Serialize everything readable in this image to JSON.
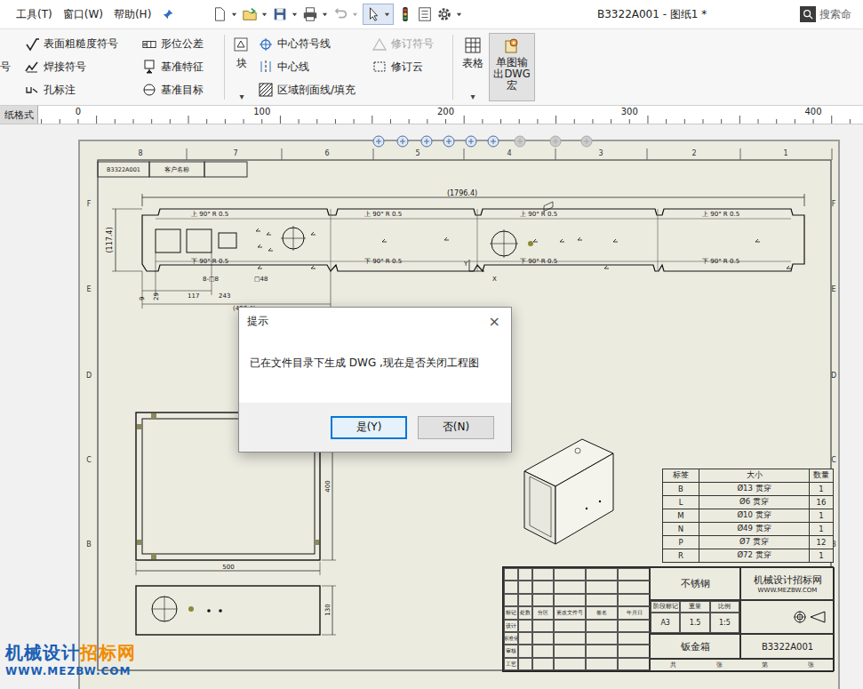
{
  "menubar": {
    "menus": [
      {
        "label": "工具(T)"
      },
      {
        "label": "窗口(W)"
      },
      {
        "label": "帮助(H)"
      }
    ],
    "title": "B3322A001 - 图纸1 *",
    "search": {
      "placeholder": "搜索命"
    }
  },
  "ribbon": {
    "cut_label": "号",
    "annotations": [
      {
        "label": "表面粗糙度符号",
        "disabled": false
      },
      {
        "label": "焊接符号",
        "disabled": false
      },
      {
        "label": "孔标注",
        "disabled": false
      }
    ],
    "tolerances": [
      {
        "label": "形位公差",
        "disabled": false
      },
      {
        "label": "基准特征",
        "disabled": false
      },
      {
        "label": "基准目标",
        "disabled": false
      }
    ],
    "block": {
      "label": "块",
      "dropdown": "▾"
    },
    "centers": [
      {
        "label": "中心符号线",
        "disabled": false
      },
      {
        "label": "中心线",
        "disabled": false
      },
      {
        "label": "区域剖面线/填充",
        "disabled": false
      }
    ],
    "revisions": [
      {
        "label": "修订符号",
        "disabled": true
      },
      {
        "label": "修订云",
        "disabled": false
      }
    ],
    "table": {
      "label": "表格",
      "dropdown": "▾"
    },
    "macro": {
      "label": "单图输出DWG宏",
      "selected": true
    }
  },
  "ruler": {
    "tab": "纸格式",
    "ticks": [
      "0",
      "100",
      "200",
      "300",
      "400"
    ]
  },
  "sheet": {
    "zones": {
      "top": [
        "8",
        "7",
        "6",
        "5",
        "4",
        "3",
        "2",
        "1"
      ],
      "left": [
        "F",
        "E",
        "D",
        "C",
        "B"
      ]
    },
    "header_cells": [
      "B3322A001",
      "客户名称"
    ],
    "flat_pattern": {
      "overall": "(1796.4)",
      "height": "(117.4)",
      "bend_up": [
        "上 90° R 0.5",
        "上 90° R 0.5",
        "上 90° R 0.5",
        "上 90° R 0.5"
      ],
      "bend_down": [
        "下 90° R 0.5",
        "下 90° R 0.5",
        "下 90° R 0.5",
        "下 90° R 0.5"
      ],
      "dims": [
        "9",
        "29",
        "117",
        "243",
        "8-□8",
        "□48",
        "(496.4)"
      ],
      "axis": [
        "Y",
        "X"
      ]
    },
    "front_view": {
      "width": "500",
      "height": "400"
    },
    "bottom_view": {
      "height": "130"
    },
    "hole_table": {
      "columns": [
        "标签",
        "大小",
        "数量"
      ],
      "rows": [
        [
          "B",
          "Ø13 贯穿",
          "1"
        ],
        [
          "L",
          "Ø6 贯穿",
          "16"
        ],
        [
          "M",
          "Ø10 贯穿",
          "1"
        ],
        [
          "N",
          "Ø49 贯穿",
          "1"
        ],
        [
          "P",
          "Ø7 贯穿",
          "12"
        ],
        [
          "R",
          "Ø72 贯穿",
          "1"
        ]
      ]
    },
    "title_block": {
      "material": "不锈钢",
      "company": "机械设计招标网",
      "url": "WWW.MEZBW.COM",
      "part_name": "钣金箱",
      "drawing_no": "B3322A001",
      "labels": [
        "标记",
        "处数",
        "分区",
        "更改文件号",
        "签名",
        "年月日"
      ],
      "roles": [
        "设计",
        "标准化",
        "审核",
        "工艺"
      ],
      "stage_header": [
        "阶段标记",
        "重量",
        "比例"
      ],
      "stage_values": [
        "A3",
        "1.5",
        "1:5"
      ],
      "footer": [
        "共",
        "张",
        "第",
        "张"
      ]
    }
  },
  "dialog": {
    "title": "提示",
    "close": "×",
    "message": "已在文件目录下生成 DWG ,现在是否关闭工程图",
    "buttons": [
      {
        "label": "是(Y)",
        "focused": true
      },
      {
        "label": "否(N)",
        "focused": false
      }
    ]
  },
  "watermark": {
    "brand": "机械设计",
    "brand_accent": "招标网",
    "url": "WWW.MEZBW.COM"
  }
}
